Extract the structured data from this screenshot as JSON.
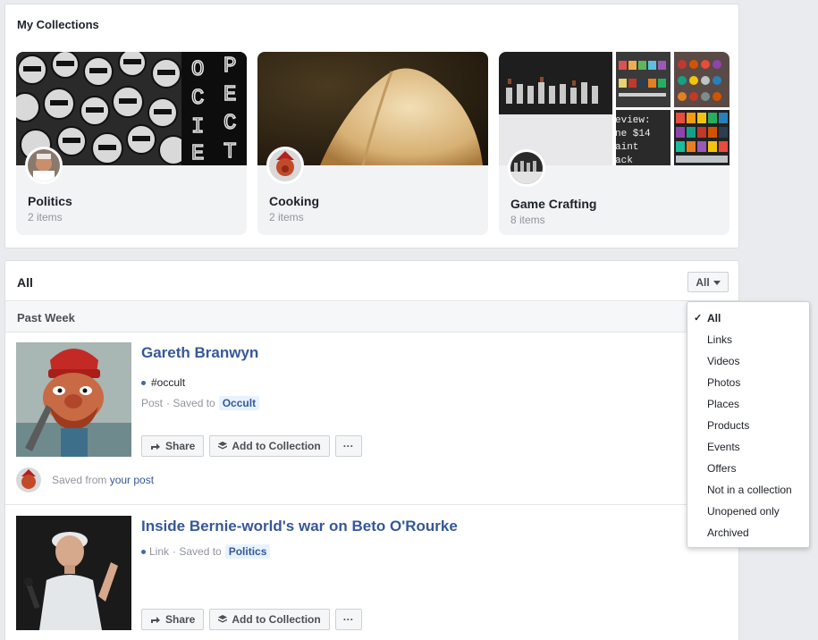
{
  "collections": {
    "title": "My Collections",
    "items": [
      {
        "name": "Politics",
        "count": "2 items"
      },
      {
        "name": "Cooking",
        "count": "2 items"
      },
      {
        "name": "Game Crafting",
        "count": "8 items"
      }
    ]
  },
  "main": {
    "title": "All",
    "filter_label": "All",
    "section_title": "Past Week",
    "items": [
      {
        "title": "Gareth Branwyn",
        "tag": "#occult",
        "type": "Post",
        "saved_to_prefix": "· Saved to",
        "collection": "Occult",
        "share_label": "Share",
        "add_label": "Add to Collection",
        "more_label": "···",
        "saved_from_text": "Saved from",
        "saved_from_link": "your post"
      },
      {
        "title": "Inside Bernie-world's war on Beto O'Rourke",
        "type": "Link",
        "saved_to_prefix": "· Saved to",
        "collection": "Politics",
        "share_label": "Share",
        "add_label": "Add to Collection",
        "more_label": "···"
      }
    ]
  },
  "filter_menu": {
    "check": "✓",
    "options": [
      "All",
      "Links",
      "Videos",
      "Photos",
      "Places",
      "Products",
      "Events",
      "Offers",
      "Not in a collection",
      "Unopened only",
      "Archived"
    ],
    "selected": "All"
  },
  "colors": {
    "link": "#365899",
    "accent": "#4267b2",
    "background": "#e9ebee"
  },
  "icons": [
    "share-icon",
    "collection-icon",
    "caret-down-icon",
    "checkmark-icon"
  ]
}
